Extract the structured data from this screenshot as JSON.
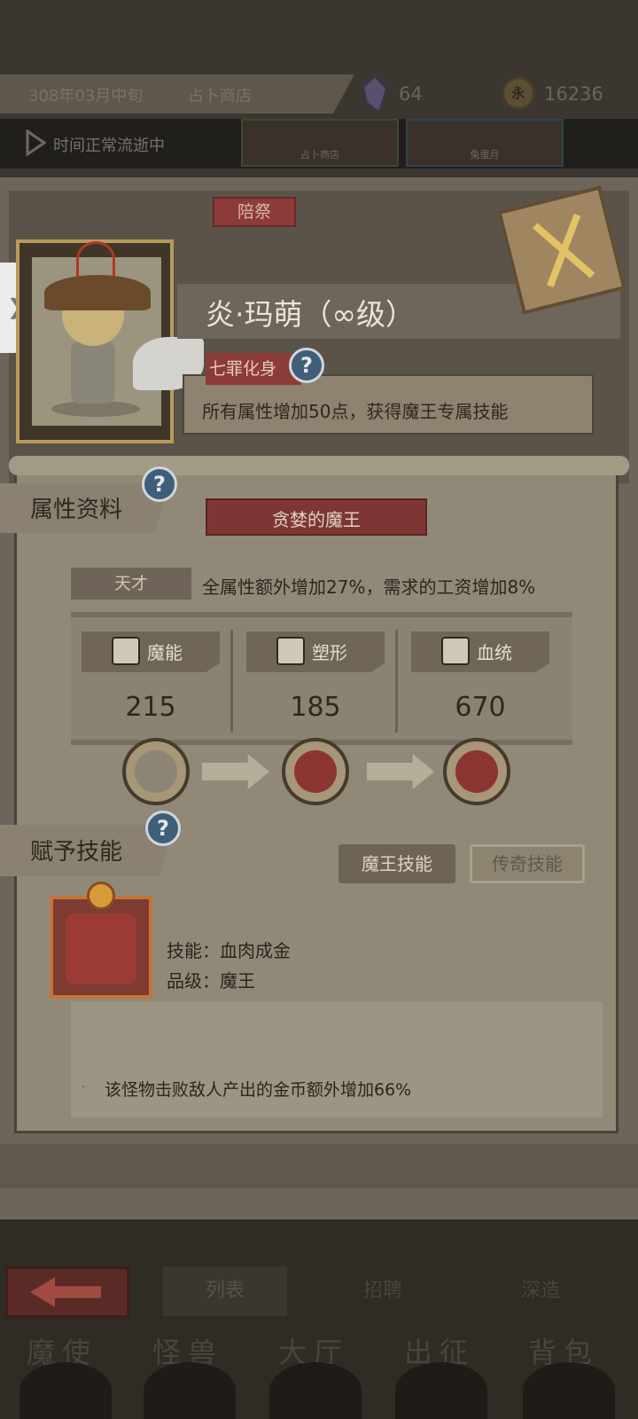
{
  "header": {
    "date": "308年03月中旬",
    "location": "占卜商店",
    "crystal_count": "64",
    "coin_icon_text": "永",
    "coins": "16236"
  },
  "time_bar": {
    "status": "时间正常流逝中",
    "thumbnails": [
      "占卜商店",
      "兔蛋月"
    ]
  },
  "tab_peiji": "陪祭",
  "character": {
    "name": "炎·玛萌（∞级）",
    "title_tag": "七罪化身",
    "title_desc": "所有属性增加50点，获得魔王专属技能"
  },
  "attributes": {
    "section_title": "属性资料",
    "class_name": "贪婪的魔王",
    "talent_label": "天才",
    "talent_desc": "全属性额外增加27%，需求的工资增加8%",
    "stats": [
      {
        "label": "魔能",
        "value": "215",
        "icon": "magic-claw-icon"
      },
      {
        "label": "塑形",
        "value": "185",
        "icon": "body-shape-icon"
      },
      {
        "label": "血统",
        "value": "670",
        "icon": "bloodline-icon"
      }
    ]
  },
  "skills": {
    "section_title": "赋予技能",
    "btn_demon": "魔王技能",
    "btn_legend": "传奇技能",
    "skill_name": "技能：血肉成金",
    "skill_grade": "品级：魔王",
    "bullet": "·",
    "description": "该怪物击败敌人产出的金币额外增加66%"
  },
  "subtabs": [
    "列表",
    "招聘",
    "深造"
  ],
  "nav": [
    "魔使",
    "怪兽",
    "大厅",
    "出征",
    "背包"
  ],
  "question_mark": "?",
  "handle_glyph": "❯",
  "colors": {
    "accent_red": "#8c3b38",
    "panel": "#6d655a",
    "parchment": "#918977",
    "gold": "#e2c364"
  }
}
